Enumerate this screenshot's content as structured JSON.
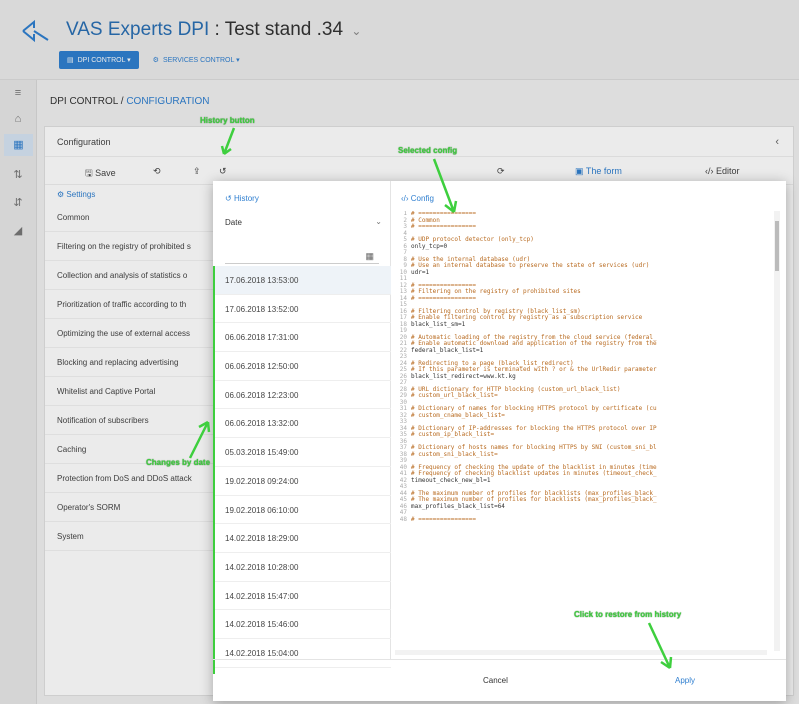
{
  "header": {
    "app_name": "VAS Experts DPI",
    "separator": ":",
    "stand_name": "Test stand .34",
    "caret": "⌄",
    "nav": [
      {
        "label": "DPI CONTROL ▾"
      },
      {
        "label": "SERVICES CONTROL ▾"
      }
    ]
  },
  "rail": {
    "icons": [
      "menu-icon",
      "home-icon",
      "grid-icon",
      "sliders-icon",
      "filter-icon",
      "chart-icon"
    ]
  },
  "breadcrumb": {
    "root": "DPI CONTROL /",
    "current": "CONFIGURATION"
  },
  "config": {
    "title": "Configuration",
    "toolbar": {
      "save": "Save",
      "form": "The form",
      "editor": "Editor"
    },
    "settings_title": "Settings",
    "settings": [
      "Common",
      "Filtering on the registry of prohibited s",
      "Collection and analysis of statistics o",
      "Prioritization of traffic according to th",
      "Optimizing the use of external access",
      "Blocking and replacing advertising",
      "Whitelist and Captive Portal",
      "Notification of subscribers",
      "Caching",
      "Protection from DoS and DDoS attack",
      "Operator's SORM",
      "System"
    ]
  },
  "history": {
    "title": "History",
    "date_label": "Date",
    "items": [
      "17.06.2018 13:53:00",
      "17.06.2018 13:52:00",
      "06.06.2018 17:31:00",
      "06.06.2018 12:50:00",
      "06.06.2018 12:23:00",
      "06.06.2018 13:32:00",
      "05.03.2018 15:49:00",
      "19.02.2018 09:24:00",
      "19.02.2018 06:10:00",
      "14.02.2018 18:29:00",
      "14.02.2018 10:28:00",
      "14.02.2018 15:47:00",
      "14.02.2018 15:46:00",
      "14.02.2018 15:04:00"
    ]
  },
  "editor": {
    "title": "Config",
    "lines": [
      {
        "n": "1",
        "t": "# ================"
      },
      {
        "n": "2",
        "t": "# Common"
      },
      {
        "n": "3",
        "t": "# ================"
      },
      {
        "n": "4",
        "t": ""
      },
      {
        "n": "5",
        "t": "# UDP protocol detector (only_tcp)"
      },
      {
        "n": "6",
        "t": "only_tcp=0"
      },
      {
        "n": "7",
        "t": ""
      },
      {
        "n": "8",
        "t": "# Use the internal database (udr)"
      },
      {
        "n": "9",
        "t": "# Use an internal database to preserve the state of services (udr)"
      },
      {
        "n": "10",
        "t": "udr=1"
      },
      {
        "n": "11",
        "t": ""
      },
      {
        "n": "12",
        "t": "# ================"
      },
      {
        "n": "13",
        "t": "# Filtering on the registry of prohibited sites"
      },
      {
        "n": "14",
        "t": "# ================"
      },
      {
        "n": "15",
        "t": ""
      },
      {
        "n": "16",
        "t": "# Filtering control by registry (black_list_sm)"
      },
      {
        "n": "17",
        "t": "# Enable filtering control by registry as a subscription service"
      },
      {
        "n": "18",
        "t": "black_list_sm=1"
      },
      {
        "n": "19",
        "t": ""
      },
      {
        "n": "20",
        "t": "# Automatic loading of the registry from the cloud service (federal_"
      },
      {
        "n": "21",
        "t": "# Enable automatic download and application of the registry from the"
      },
      {
        "n": "22",
        "t": "federal_black_list=1"
      },
      {
        "n": "23",
        "t": ""
      },
      {
        "n": "24",
        "t": "# Redirecting to a page (black_list_redirect)"
      },
      {
        "n": "25",
        "t": "# If this parameter is terminated with ? or & the UrlRedir parameter"
      },
      {
        "n": "26",
        "t": "black_list_redirect=www.kt.kg"
      },
      {
        "n": "27",
        "t": ""
      },
      {
        "n": "28",
        "t": "# URL dictionary for HTTP blocking (custom_url_black_list)"
      },
      {
        "n": "29",
        "t": "# custom_url_black_list="
      },
      {
        "n": "30",
        "t": ""
      },
      {
        "n": "31",
        "t": "# Dictionary of names for blocking HTTPS protocol by certificate (cu"
      },
      {
        "n": "32",
        "t": "# custom_cname_black_list="
      },
      {
        "n": "33",
        "t": ""
      },
      {
        "n": "34",
        "t": "# Dictionary of IP-addresses for blocking the HTTPS protocol over IP"
      },
      {
        "n": "35",
        "t": "# custom_ip_black_list="
      },
      {
        "n": "36",
        "t": ""
      },
      {
        "n": "37",
        "t": "# Dictionary of hosts names for blocking HTTPS by SNI (custom_sni_bl"
      },
      {
        "n": "38",
        "t": "# custom_sni_black_list="
      },
      {
        "n": "39",
        "t": ""
      },
      {
        "n": "40",
        "t": "# Frequency of checking the update of the blacklist in minutes (time"
      },
      {
        "n": "41",
        "t": "# Frequency of checking blacklist updates in minutes (timeout_check_"
      },
      {
        "n": "42",
        "t": "timeout_check_new_bl=1"
      },
      {
        "n": "43",
        "t": ""
      },
      {
        "n": "44",
        "t": "# The maximum number of profiles for blacklists (max_profiles_black_"
      },
      {
        "n": "45",
        "t": "# The maximum number of profiles for blacklists (max_profiles_black_"
      },
      {
        "n": "46",
        "t": "max_profiles_black_list=64"
      },
      {
        "n": "47",
        "t": ""
      },
      {
        "n": "48",
        "t": "# ================"
      }
    ]
  },
  "footer": {
    "cancel": "Cancel",
    "apply": "Apply"
  },
  "annotations": {
    "history_button": "History button",
    "selected_config": "Selected config",
    "change_by_date": "Changes by date",
    "click_to_restore": "Click to restore from history"
  },
  "colors": {
    "accent": "#2f7fd0",
    "annotation": "#3ecf3e",
    "code_comment": "#b86a1f"
  }
}
